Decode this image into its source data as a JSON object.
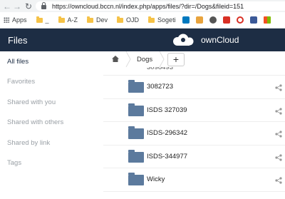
{
  "browser": {
    "url": "https://owncloud.bccn.nl/index.php/apps/files/?dir=/Dogs&fileid=151",
    "bookmarks": [
      "Apps",
      "_",
      "A-Z",
      "Dev",
      "OJD",
      "Sogeti"
    ]
  },
  "header": {
    "app_title": "Files",
    "brand": "ownCloud"
  },
  "sidebar": {
    "items": [
      {
        "label": "All files"
      },
      {
        "label": "Favorites"
      },
      {
        "label": "Shared with you"
      },
      {
        "label": "Shared with others"
      },
      {
        "label": "Shared by link"
      },
      {
        "label": "Tags"
      }
    ]
  },
  "breadcrumb": {
    "current": "Dogs",
    "add_label": "+"
  },
  "files": [
    {
      "name": "3082723"
    },
    {
      "name": "ISDS 327039"
    },
    {
      "name": "ISDS-296342"
    },
    {
      "name": "ISDS-344977"
    },
    {
      "name": "Wicky"
    }
  ],
  "colors": {
    "header_bg": "#1d2d44",
    "folder": "#5c7a9d"
  }
}
